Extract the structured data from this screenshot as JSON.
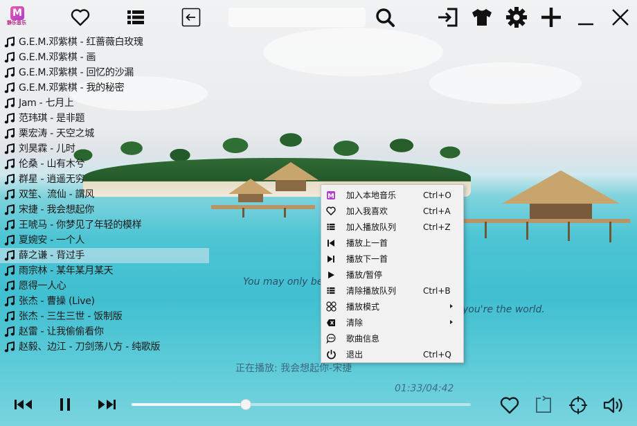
{
  "app": {
    "logo_text": "静乐音乐",
    "logo_glyph": "M",
    "accent_color": "#c23a9b"
  },
  "toolbar": {
    "icons": [
      "favorite-heart-icon",
      "list-icon",
      "back-icon",
      "search-icon",
      "logout-icon",
      "skin-shirt-icon",
      "settings-gear-icon",
      "add-plus-icon",
      "minimize-icon",
      "close-icon"
    ],
    "search_value": ""
  },
  "playlist": {
    "items": [
      {
        "title": "G.E.M.邓紫棋 - 红蔷薇白玫瑰"
      },
      {
        "title": "G.E.M.邓紫棋 - 画"
      },
      {
        "title": "G.E.M.邓紫棋 - 回忆的沙漏"
      },
      {
        "title": "G.E.M.邓紫棋 - 我的秘密"
      },
      {
        "title": "Jam - 七月上"
      },
      {
        "title": "范玮琪 - 是非题"
      },
      {
        "title": "栗宏涛 - 天空之城"
      },
      {
        "title": "刘昊霖 - 儿时"
      },
      {
        "title": "伦桑 - 山有木兮"
      },
      {
        "title": "群星 - 逍遥无穷"
      },
      {
        "title": "双笙、流仙 - 謂风"
      },
      {
        "title": "宋捷 - 我会想起你"
      },
      {
        "title": "王唬马 - 你梦见了年轻的模样"
      },
      {
        "title": "夏婉安 - 一个人"
      },
      {
        "title": "薛之谦 - 背过手"
      },
      {
        "title": "雨宗林 - 某年某月某天"
      },
      {
        "title": "愿得一人心"
      },
      {
        "title": "张杰 - 曹操 (Live)"
      },
      {
        "title": "张杰 - 三生三世 - 饭制版"
      },
      {
        "title": "赵雷 - 让我偷偷看你"
      },
      {
        "title": "赵毅、边江 - 刀剑荡八方 - 纯歌版"
      }
    ],
    "highlighted_index": 14
  },
  "lyrics": {
    "line1": "You may only be",
    "line2": "you're the world."
  },
  "status": {
    "now_playing": "正在播放: 我会想起你-宋捷",
    "time": "01:33/04:42",
    "progress": 0.337
  },
  "context_menu": {
    "items": [
      {
        "label": "加入本地音乐",
        "shortcut": "Ctrl+O",
        "icon": "music-logo-icon",
        "submenu": false
      },
      {
        "label": "加入我喜欢",
        "shortcut": "Ctrl+A",
        "icon": "heart-icon",
        "submenu": false
      },
      {
        "label": "加入播放队列",
        "shortcut": "Ctrl+Z",
        "icon": "list-icon",
        "submenu": false
      },
      {
        "label": "播放上一首",
        "shortcut": "",
        "icon": "previous-icon",
        "submenu": false
      },
      {
        "label": "播放下一首",
        "shortcut": "",
        "icon": "next-icon",
        "submenu": false
      },
      {
        "label": "播放/暂停",
        "shortcut": "",
        "icon": "play-icon",
        "submenu": false
      },
      {
        "label": "清除播放队列",
        "shortcut": "Ctrl+B",
        "icon": "list-icon",
        "submenu": false
      },
      {
        "label": "播放模式",
        "shortcut": "",
        "icon": "mode-grid-icon",
        "submenu": true
      },
      {
        "label": "清除",
        "shortcut": "",
        "icon": "clear-icon",
        "submenu": true
      },
      {
        "label": "歌曲信息",
        "shortcut": "",
        "icon": "info-chat-icon",
        "submenu": false
      },
      {
        "label": "退出",
        "shortcut": "Ctrl+Q",
        "icon": "power-icon",
        "submenu": false
      }
    ]
  },
  "controls": {
    "icons": [
      "previous-track-icon",
      "pause-icon",
      "next-track-icon",
      "like-heart-icon",
      "repeat-icon",
      "locate-target-icon",
      "volume-icon"
    ]
  }
}
